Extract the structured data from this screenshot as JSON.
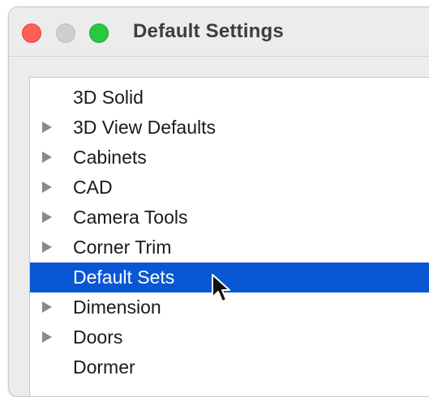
{
  "window": {
    "title": "Default Settings"
  },
  "tree": {
    "items": [
      {
        "label": "3D Solid",
        "expandable": false,
        "selected": false
      },
      {
        "label": "3D View Defaults",
        "expandable": true,
        "selected": false
      },
      {
        "label": "Cabinets",
        "expandable": true,
        "selected": false
      },
      {
        "label": "CAD",
        "expandable": true,
        "selected": false
      },
      {
        "label": "Camera Tools",
        "expandable": true,
        "selected": false
      },
      {
        "label": "Corner Trim",
        "expandable": true,
        "selected": false
      },
      {
        "label": "Default Sets",
        "expandable": false,
        "selected": true
      },
      {
        "label": "Dimension",
        "expandable": true,
        "selected": false
      },
      {
        "label": "Doors",
        "expandable": true,
        "selected": false
      },
      {
        "label": "Dormer",
        "expandable": false,
        "selected": false
      }
    ]
  },
  "colors": {
    "selection": "#0a57d6",
    "close": "#fe5f57",
    "minimize": "#cfcfcf",
    "zoom": "#28c840"
  }
}
